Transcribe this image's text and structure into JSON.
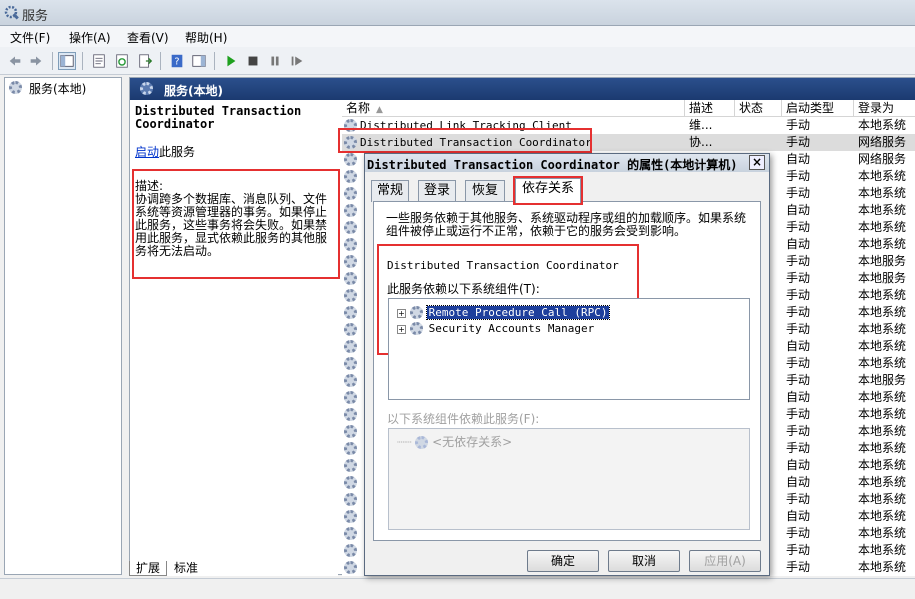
{
  "window": {
    "title": "服务"
  },
  "menu": [
    "文件(F)",
    "操作(A)",
    "查看(V)",
    "帮助(H)"
  ],
  "tree": {
    "root_label": "服务(本地)"
  },
  "content_header": {
    "title": "服务(本地)"
  },
  "description_panel": {
    "service_name_line1": "Distributed Transaction",
    "service_name_line2": "Coordinator",
    "start_link": "启动",
    "start_suffix": "此服务",
    "desc_label": "描述:",
    "desc_text": "协调跨多个数据库、消息队列、文件系统等资源管理器的事务。如果停止此服务，这些事务将会失败。如果禁用此服务，显式依赖此服务的其他服务将无法启动。"
  },
  "list": {
    "columns": [
      "名称",
      "描述",
      "状态",
      "启动类型",
      "登录为"
    ],
    "rows": [
      {
        "name": "Distributed Link Tracking Client",
        "desc": "维...",
        "status": "",
        "startup": "手动",
        "logon": "本地系统"
      },
      {
        "name": "Distributed Transaction Coordinator",
        "desc": "协...",
        "status": "",
        "startup": "手动",
        "logon": "网络服务"
      },
      {
        "name": "",
        "desc": "",
        "status": "",
        "startup": "自动",
        "logon": "网络服务"
      },
      {
        "name": "",
        "desc": "",
        "status": "",
        "startup": "手动",
        "logon": "本地系统"
      },
      {
        "name": "",
        "desc": "",
        "status": "",
        "startup": "手动",
        "logon": "本地系统"
      },
      {
        "name": "",
        "desc": "",
        "status": "",
        "startup": "自动",
        "logon": "本地系统"
      },
      {
        "name": "",
        "desc": "",
        "status": "",
        "startup": "手动",
        "logon": "本地系统"
      },
      {
        "name": "",
        "desc": "",
        "status": "",
        "startup": "自动",
        "logon": "本地系统"
      },
      {
        "name": "",
        "desc": "",
        "status": "",
        "startup": "手动",
        "logon": "本地服务"
      },
      {
        "name": "",
        "desc": "",
        "status": "",
        "startup": "手动",
        "logon": "本地服务"
      },
      {
        "name": "",
        "desc": "",
        "status": "",
        "startup": "手动",
        "logon": "本地系统"
      },
      {
        "name": "",
        "desc": "",
        "status": "",
        "startup": "手动",
        "logon": "本地系统"
      },
      {
        "name": "",
        "desc": "",
        "status": "",
        "startup": "手动",
        "logon": "本地系统"
      },
      {
        "name": "",
        "desc": "",
        "status": "",
        "startup": "自动",
        "logon": "本地系统"
      },
      {
        "name": "",
        "desc": "",
        "status": "",
        "startup": "手动",
        "logon": "本地系统"
      },
      {
        "name": "",
        "desc": "",
        "status": "",
        "startup": "手动",
        "logon": "本地服务"
      },
      {
        "name": "",
        "desc": "",
        "status": "",
        "startup": "自动",
        "logon": "本地系统"
      },
      {
        "name": "",
        "desc": "",
        "status": "",
        "startup": "手动",
        "logon": "本地系统"
      },
      {
        "name": "",
        "desc": "",
        "status": "",
        "startup": "手动",
        "logon": "本地系统"
      },
      {
        "name": "",
        "desc": "",
        "status": "",
        "startup": "手动",
        "logon": "本地系统"
      },
      {
        "name": "",
        "desc": "",
        "status": "",
        "startup": "自动",
        "logon": "本地系统"
      },
      {
        "name": "",
        "desc": "",
        "status": "",
        "startup": "自动",
        "logon": "本地系统"
      },
      {
        "name": "",
        "desc": "",
        "status": "",
        "startup": "手动",
        "logon": "本地系统"
      },
      {
        "name": "",
        "desc": "",
        "status": "",
        "startup": "自动",
        "logon": "本地系统"
      },
      {
        "name": "",
        "desc": "",
        "status": "",
        "startup": "手动",
        "logon": "本地系统"
      },
      {
        "name": "",
        "desc": "",
        "status": "",
        "startup": "手动",
        "logon": "本地系统"
      },
      {
        "name": "",
        "desc": "",
        "status": "",
        "startup": "手动",
        "logon": "本地系统"
      }
    ]
  },
  "bottom_tabs": [
    "扩展",
    "标准"
  ],
  "dialog": {
    "title": "Distributed Transaction Coordinator 的属性(本地计算机)",
    "close": "×",
    "tabs": [
      "常规",
      "登录",
      "恢复",
      "依存关系"
    ],
    "intro": "一些服务依赖于其他服务、系统驱动程序或组的加载顺序。如果系统组件被停止或运行不正常，依赖于它的服务会受到影响。",
    "service_name": "Distributed Transaction Coordinator",
    "depends_on_label": "此服务依赖以下系统组件(T):",
    "depends_on": [
      "Remote Procedure Call (RPC)",
      "Security Accounts Manager"
    ],
    "dependents_label": "以下系统组件依赖此服务(F):",
    "dependents": [
      "<无依存关系>"
    ],
    "buttons": {
      "ok": "确定",
      "cancel": "取消",
      "apply": "应用(A)"
    }
  }
}
